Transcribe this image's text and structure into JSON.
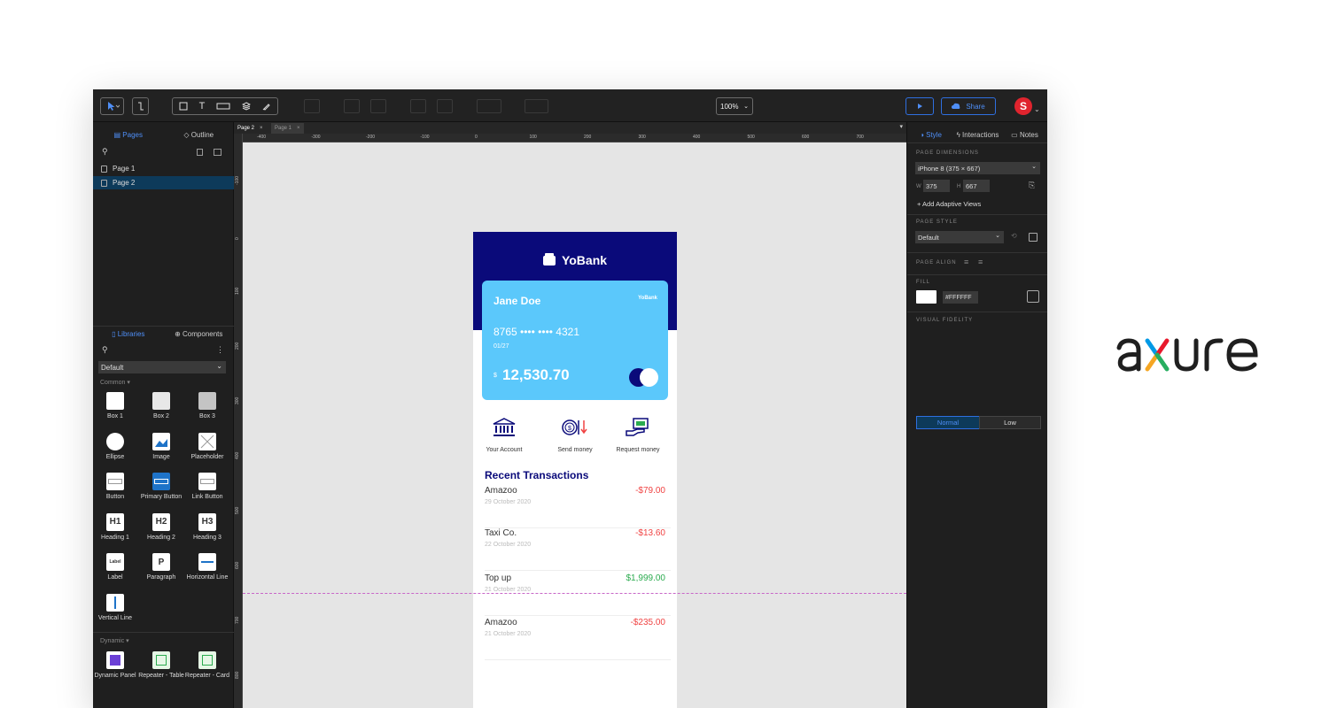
{
  "toolbar": {
    "zoom": "100%",
    "share": "Share",
    "avatar_initial": "S"
  },
  "left_panel": {
    "tabs": [
      "Pages",
      "Outline"
    ],
    "pages": [
      "Page 1",
      "Page 2"
    ],
    "lib_tabs": [
      "Libraries",
      "Components"
    ],
    "library": "Default",
    "common_label": "Common ▾",
    "dynamic_label": "Dynamic ▾",
    "widgets": [
      {
        "label": "Box 1"
      },
      {
        "label": "Box 2"
      },
      {
        "label": "Box 3"
      },
      {
        "label": "Ellipse"
      },
      {
        "label": "Image"
      },
      {
        "label": "Placeholder"
      },
      {
        "label": "Button"
      },
      {
        "label": "Primary Button"
      },
      {
        "label": "Link Button"
      },
      {
        "label": "Heading 1",
        "glyph": "H1"
      },
      {
        "label": "Heading 2",
        "glyph": "H2"
      },
      {
        "label": "Heading 3",
        "glyph": "H3"
      },
      {
        "label": "Label",
        "glyph": "Label"
      },
      {
        "label": "Paragraph",
        "glyph": "P"
      },
      {
        "label": "Horizontal Line"
      },
      {
        "label": "Vertical Line"
      }
    ],
    "dynamic_widgets": [
      {
        "label": "Dynamic Panel"
      },
      {
        "label": "Repeater - Table"
      },
      {
        "label": "Repeater - Card"
      }
    ]
  },
  "canvas": {
    "doc_tabs": [
      "Page 2",
      "Page 1"
    ],
    "ruler_h": [
      "-400",
      "-300",
      "-200",
      "-100",
      "0",
      "100",
      "200",
      "300",
      "400",
      "500",
      "600",
      "700"
    ],
    "ruler_v": [
      "-100",
      "0",
      "100",
      "200",
      "300",
      "400",
      "500",
      "600",
      "700",
      "800"
    ]
  },
  "app": {
    "brand": "YoBank",
    "card": {
      "name": "Jane Doe",
      "mini_brand": "YoBank",
      "number": "8765 •••• •••• 4321",
      "expiry": "01/27",
      "currency": "$",
      "balance": "12,530.70"
    },
    "actions": [
      "Your Account",
      "Send money",
      "Request money"
    ],
    "recent_title": "Recent Transactions",
    "transactions": [
      {
        "merchant": "Amazoo",
        "date": "29 October 2020",
        "amount": "-$79.00",
        "type": "neg"
      },
      {
        "merchant": "Taxi Co.",
        "date": "22 October 2020",
        "amount": "-$13.60",
        "type": "neg"
      },
      {
        "merchant": "Top up",
        "date": "21 October 2020",
        "amount": "$1,999.00",
        "type": "pos"
      },
      {
        "merchant": "Amazoo",
        "date": "21 October 2020",
        "amount": "-$235.00",
        "type": "neg"
      }
    ],
    "colors": {
      "header": "#0a0a7a",
      "card": "#5bc8fb",
      "negative": "#f04343",
      "positive": "#2bab4f"
    }
  },
  "right_panel": {
    "tabs": [
      "Style",
      "Interactions",
      "Notes"
    ],
    "page_dimensions_label": "PAGE DIMENSIONS",
    "page_dimensions": "iPhone 8  (375 × 667)",
    "w_label": "W",
    "width": "375",
    "h_label": "H",
    "height": "667",
    "adaptive": "+ Add Adaptive Views",
    "page_style_label": "PAGE STYLE",
    "page_style": "Default",
    "page_align_label": "PAGE ALIGN",
    "fill_label": "FILL",
    "fill_hex": "#FFFFFF",
    "fidelity_label": "VISUAL FIDELITY",
    "fidelity": [
      "Normal",
      "Low"
    ]
  },
  "logo": {
    "text": "axure"
  }
}
